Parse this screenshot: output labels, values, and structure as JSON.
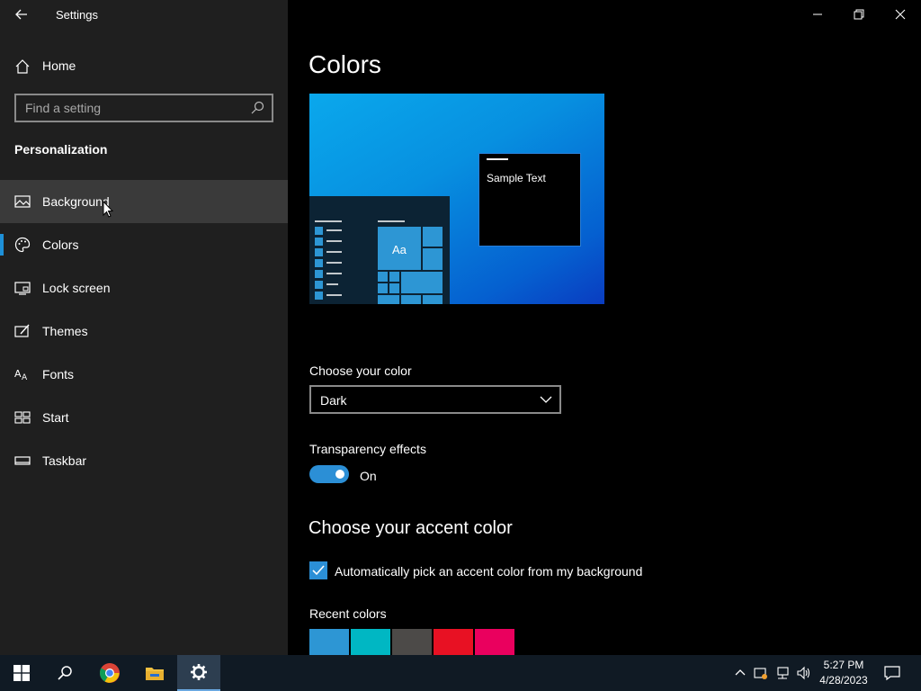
{
  "window": {
    "title": "Settings",
    "controls": [
      "minimize-icon",
      "restore-icon",
      "close-icon"
    ]
  },
  "sidebar": {
    "home_label": "Home",
    "search_placeholder": "Find a setting",
    "section_title": "Personalization",
    "items": [
      {
        "label": "Background",
        "icon": "picture-icon",
        "state": "hover"
      },
      {
        "label": "Colors",
        "icon": "palette-icon",
        "state": "selected"
      },
      {
        "label": "Lock screen",
        "icon": "lock-screen-icon",
        "state": ""
      },
      {
        "label": "Themes",
        "icon": "themes-icon",
        "state": ""
      },
      {
        "label": "Fonts",
        "icon": "fonts-icon",
        "state": ""
      },
      {
        "label": "Start",
        "icon": "start-icon",
        "state": ""
      },
      {
        "label": "Taskbar",
        "icon": "taskbar-icon",
        "state": ""
      }
    ]
  },
  "main": {
    "title": "Colors",
    "preview": {
      "sample_text": "Sample Text",
      "tile_text": "Aa"
    },
    "choose_color_label": "Choose your color",
    "choose_color_value": "Dark",
    "transparency_label": "Transparency effects",
    "transparency_state": "On",
    "accent_heading": "Choose your accent color",
    "auto_accent_label": "Automatically pick an accent color from my background",
    "auto_accent_checked": true,
    "recent_colors_label": "Recent colors",
    "recent_colors": [
      "#2d96d4",
      "#00b7c3",
      "#4c4a48",
      "#e81123",
      "#ea005e"
    ]
  },
  "taskbar": {
    "apps": [
      "start-icon",
      "search-icon",
      "chrome-icon",
      "file-explorer-icon",
      "settings-icon"
    ],
    "active_app": "settings-icon",
    "time": "5:27 PM",
    "date": "4/28/2023"
  },
  "colors": {
    "accent": "#2b8fd6",
    "sidebar_bg": "#1f1f1f",
    "main_bg": "#000000"
  }
}
